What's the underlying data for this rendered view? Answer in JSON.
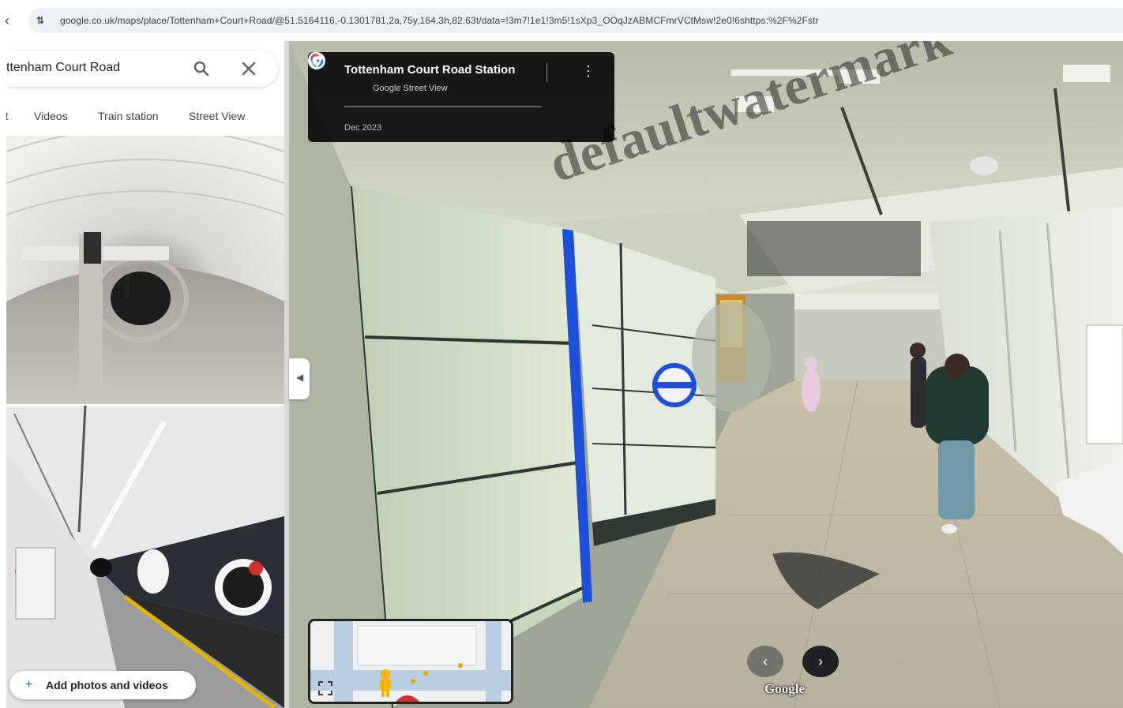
{
  "browser": {
    "url": "google.co.uk/maps/place/Tottenham+Court+Road/@51.5164116,-0.1301781,2a,75y,164.3h,82.63t/data=!3m7!1e1!3m5!1sXp3_OOqJzABMCFmrVCtMsw!2e0!6shttps:%2F%2Fstr"
  },
  "sidebar": {
    "search_value": "ttenham Court Road",
    "chips": [
      "rt",
      "Videos",
      "Train station",
      "Street View"
    ],
    "add_photos_label": "Add photos and videos"
  },
  "streetview": {
    "place_title": "Tottenham Court Road Station",
    "source": "Google Street View",
    "date": "Dec 2023",
    "brand": "Google",
    "watermark": "defaultwatermark"
  },
  "icons": {
    "search": "search-icon",
    "close": "close-icon",
    "pin": "location-pin-icon",
    "more": "more-vert-icon",
    "collapse": "chevron-left-icon",
    "prev": "chevron-left-icon",
    "next": "chevron-right-icon",
    "fullscreen": "fullscreen-icon",
    "pegman": "pegman-icon"
  },
  "colors": {
    "accent": "#1a73e8",
    "info_card": "#000000",
    "tile_blue": "#1e4fd8"
  }
}
